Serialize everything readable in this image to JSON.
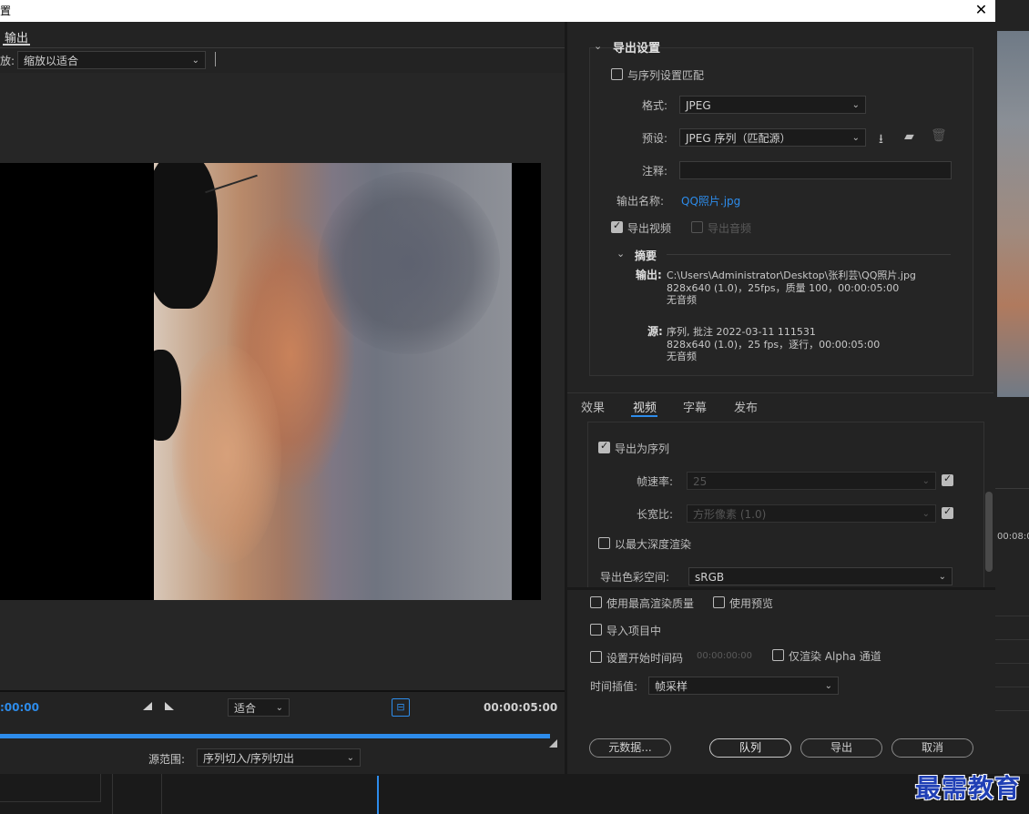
{
  "title_bar": {
    "title": "置",
    "close_glyph": "✕"
  },
  "left": {
    "tab_output": "输出",
    "scale_label": "放:",
    "scale_value": "缩放以适合",
    "timecode_in": ":00:00",
    "timecode_out": "00:00:05:00",
    "zoom_value": "适合",
    "source_range_label": "源范围:",
    "source_range_value": "序列切入/序列切出"
  },
  "export_settings": {
    "header": "导出设置",
    "match_sequence_label": "与序列设置匹配",
    "match_sequence_checked": false,
    "format_label": "格式:",
    "format_value": "JPEG",
    "preset_label": "预设:",
    "preset_value": "JPEG 序列（匹配源）",
    "comment_label": "注释:",
    "comment_value": "",
    "output_name_label": "输出名称:",
    "output_name_value": "QQ照片.jpg",
    "export_video_label": "导出视频",
    "export_video_checked": true,
    "export_audio_label": "导出音频",
    "export_audio_checked": false
  },
  "summary": {
    "header": "摘要",
    "output_label": "输出:",
    "output_path": "C:\\Users\\Administrator\\Desktop\\张利芸\\QQ照片.jpg",
    "output_detail": "828x640 (1.0)，25fps，质量 100，00:00:05:00",
    "output_audio": "无音频",
    "source_label": "源:",
    "source_name": "序列, 批注 2022-03-11 111531",
    "source_detail": "828x640 (1.0)，25 fps，逐行，00:00:05:00",
    "source_audio": "无音频"
  },
  "tabs": [
    "效果",
    "视频",
    "字幕",
    "发布"
  ],
  "active_tab": "视频",
  "video": {
    "export_sequence_label": "导出为序列",
    "export_sequence_checked": true,
    "frame_rate_label": "帧速率:",
    "frame_rate_value": "25",
    "frame_rate_lock_checked": true,
    "aspect_label": "长宽比:",
    "aspect_value": "方形像素 (1.0)",
    "aspect_lock_checked": true,
    "max_depth_label": "以最大深度渲染",
    "max_depth_checked": false,
    "color_space_label": "导出色彩空间:",
    "color_space_value": "sRGB"
  },
  "options": {
    "max_quality_label": "使用最高渲染质量",
    "use_preview_label": "使用预览",
    "import_project_label": "导入项目中",
    "set_timecode_label": "设置开始时间码",
    "set_timecode_value": "00:00:00:00",
    "alpha_only_label": "仅渲染 Alpha 通道",
    "time_interp_label": "时间插值:",
    "time_interp_value": "帧采样"
  },
  "buttons": {
    "metadata": "元数据...",
    "queue": "队列",
    "export": "导出",
    "cancel": "取消"
  },
  "background": {
    "timecode": "00:08:0"
  },
  "watermark": "最需教育",
  "colors": {
    "accent": "#2d8ceb",
    "panel": "#232323",
    "watermark": "#1f3fb5"
  }
}
